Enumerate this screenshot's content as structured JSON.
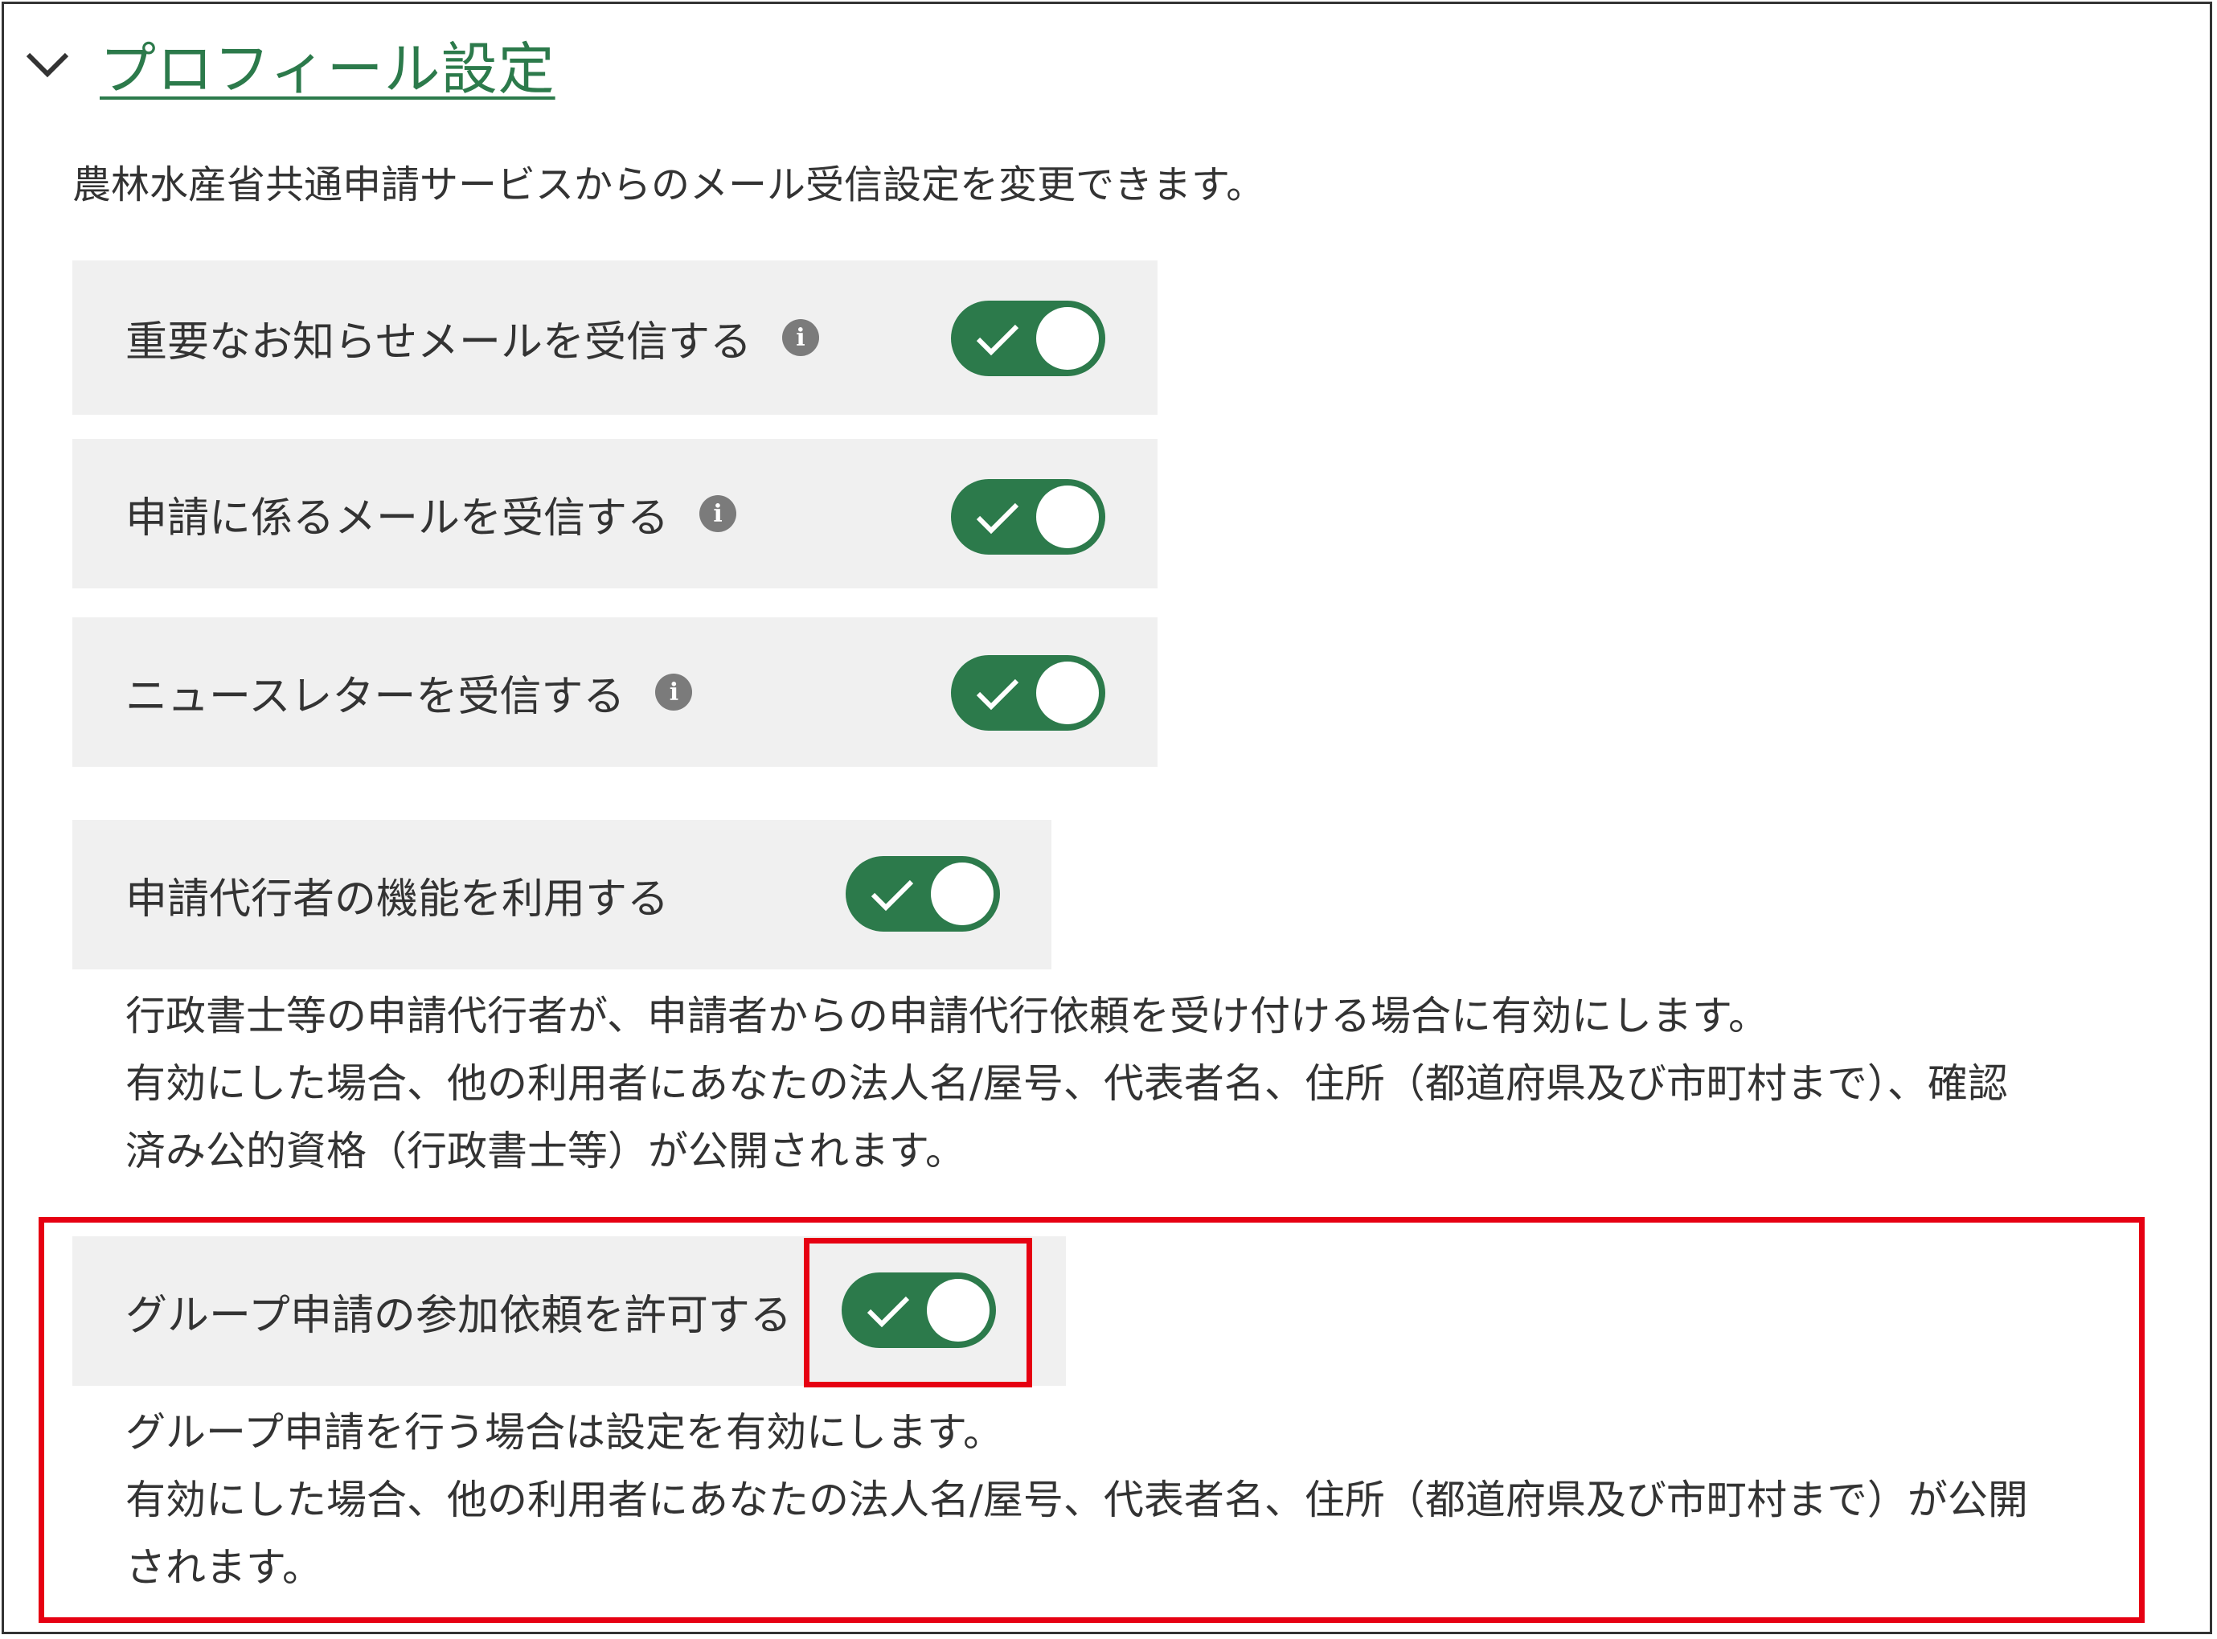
{
  "section": {
    "title": "プロフィール設定",
    "intro": "農林水産省共通申請サービスからのメール受信設定を変更できます。"
  },
  "settings": [
    {
      "label": "重要なお知らせメールを受信する",
      "enabled": true
    },
    {
      "label": "申請に係るメールを受信する",
      "enabled": true
    },
    {
      "label": "ニュースレターを受信する",
      "enabled": true
    }
  ],
  "proxy": {
    "label": "申請代行者の機能を利用する",
    "enabled": true,
    "desc_line1": "行政書士等の申請代行者が、申請者からの申請代行依頼を受け付ける場合に有効にします。",
    "desc_line2": "有効にした場合、他の利用者にあなたの法人名/屋号、代表者名、住所（都道府県及び市町村まで）、確認",
    "desc_line3": "済み公的資格（行政書士等）が公開されます。"
  },
  "group": {
    "label": "グループ申請の参加依頼を許可する",
    "enabled": true,
    "desc_line1": "グループ申請を行う場合は設定を有効にします。",
    "desc_line2": "有効にした場合、他の利用者にあなたの法人名/屋号、代表者名、住所（都道府県及び市町村まで）が公開",
    "desc_line3": "されます。"
  },
  "colors": {
    "accent": "#2c7a4b",
    "highlight": "#e60012",
    "panel_bg": "#f0f0f0"
  },
  "icons": {
    "collapse": "chevron-down-icon",
    "info": "info-icon",
    "toggle_on": "check-icon"
  }
}
